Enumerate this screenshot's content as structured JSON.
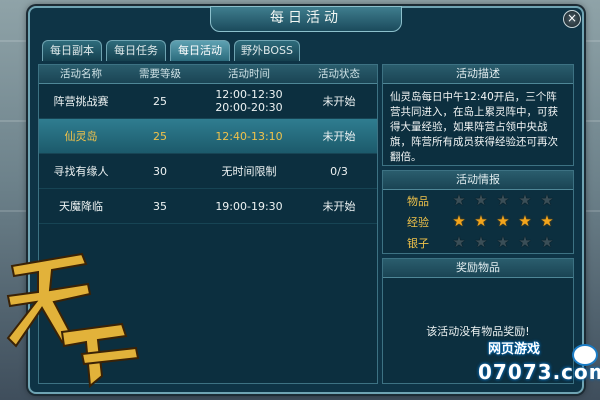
{
  "window": {
    "title": "每日活动",
    "close": "×"
  },
  "tabs": [
    {
      "label": "每日副本"
    },
    {
      "label": "每日任务"
    },
    {
      "label": "每日活动"
    },
    {
      "label": "野外BOSS"
    }
  ],
  "table": {
    "headers": [
      "活动名称",
      "需要等级",
      "活动时间",
      "活动状态"
    ],
    "rows": [
      {
        "name": "阵营挑战赛",
        "level": "25",
        "time": "12:00-12:30",
        "time2": "20:00-20:30",
        "status": "未开始"
      },
      {
        "name": "仙灵岛",
        "level": "25",
        "time": "12:40-13:10",
        "time2": "",
        "status": "未开始"
      },
      {
        "name": "寻找有缘人",
        "level": "30",
        "time": "无时间限制",
        "time2": "",
        "status": "0/3"
      },
      {
        "name": "天魔降临",
        "level": "35",
        "time": "19:00-19:30",
        "time2": "",
        "status": "未开始"
      }
    ]
  },
  "description": {
    "title": "活动描述",
    "text": "仙灵岛每日中午12:40开启，三个阵营共同进入，在岛上累灵阵中，可获得大量经验，如果阵营占领中央战旗，阵营所有成员获得经验还可再次翻倍。"
  },
  "intel": {
    "title": "活动情报",
    "items": [
      {
        "label": "物品",
        "stars": 0,
        "max": 5
      },
      {
        "label": "经验",
        "stars": 5,
        "max": 5
      },
      {
        "label": "银子",
        "stars": 0,
        "max": 5
      }
    ]
  },
  "reward": {
    "title": "奖励物品",
    "text": "该活动没有物品奖励!"
  },
  "decor": {
    "logo": "天界",
    "watermark_top": "网页游戏",
    "watermark_bottom": "07073.com"
  },
  "colors": {
    "selected_text": "#f0c24a",
    "star_on": "#f2a51c",
    "star_off": "#3a4e57"
  }
}
